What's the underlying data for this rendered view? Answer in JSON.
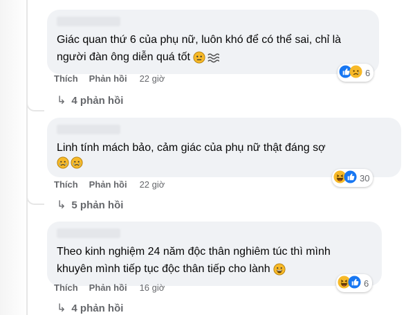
{
  "comments": [
    {
      "text": "Giác quan thứ 6 của phụ nữ, luôn khó để có thể sai, chỉ là\nngười đàn ông diễn quá tốt",
      "inline_emojis": [
        "neutral-face-emoji",
        "wave-emoji"
      ],
      "actions": {
        "like": "Thích",
        "reply": "Phản hồi",
        "time": "22 giờ"
      },
      "reactions": {
        "icons": [
          "like-reaction-icon",
          "sad-reaction-icon"
        ],
        "count": "6"
      },
      "replies_label": "4 phản hồi"
    },
    {
      "text": "Linh tính mách bảo, cảm giác của phụ nữ thật đáng sợ",
      "inline_emojis": [
        "crying-face-emoji",
        "crying-face-emoji"
      ],
      "actions": {
        "like": "Thích",
        "reply": "Phản hồi",
        "time": "22 giờ"
      },
      "reactions": {
        "icons": [
          "haha-reaction-icon",
          "like-reaction-icon"
        ],
        "count": "30"
      },
      "replies_label": "5 phản hồi"
    },
    {
      "text": "Theo kinh nghiệm 24 năm độc thân nghiêm túc thì mình\nkhuyên mình tiếp tục độc thân tiếp cho lành",
      "inline_emojis": [
        "grinning-face-emoji"
      ],
      "actions": {
        "like": "Thích",
        "reply": "Phản hồi",
        "time": "16 giờ"
      },
      "reactions": {
        "icons": [
          "haha-reaction-icon",
          "like-reaction-icon"
        ],
        "count": "6"
      },
      "replies_label": "4 phản hồi"
    }
  ],
  "colors": {
    "bubble": "#f0f2f5",
    "meta_text": "#65676b",
    "like_blue": "#1877f2",
    "emoji_yellow": "#f7b928"
  }
}
